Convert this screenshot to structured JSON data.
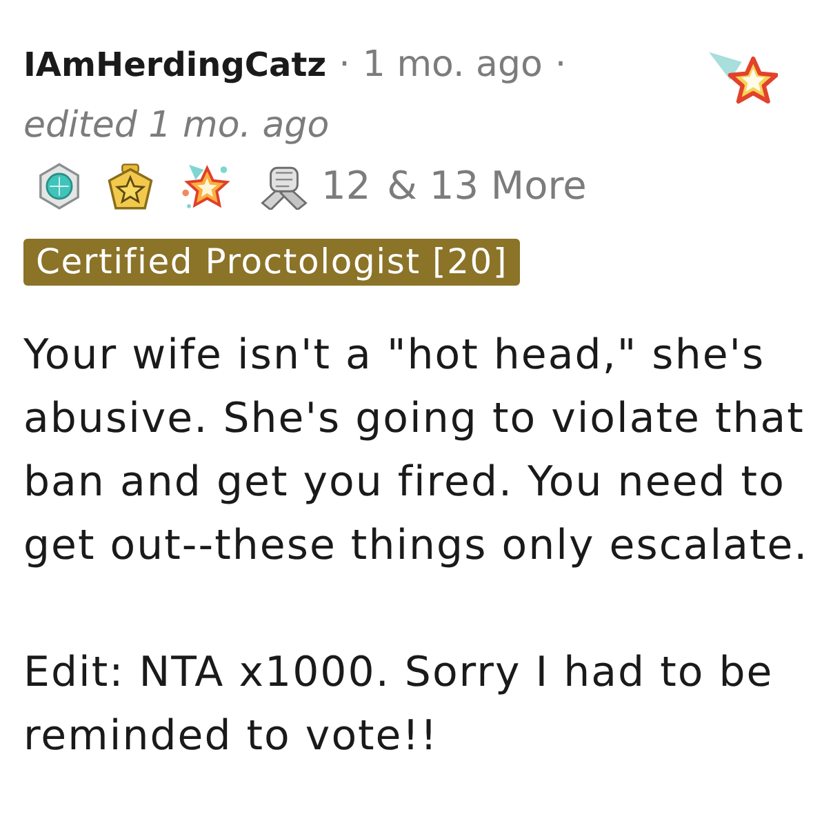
{
  "comment": {
    "author": "IAmHerdingCatz",
    "separator_1": "·",
    "time": "1 mo. ago",
    "separator_2": "·",
    "edited": "edited 1 mo. ago",
    "awards": [
      {
        "kind": "medal"
      },
      {
        "kind": "badge"
      },
      {
        "kind": "starburst"
      },
      {
        "kind": "handshake"
      }
    ],
    "award_count": "12",
    "more_awards": "& 13 More",
    "flair": "Certified Proctologist [20]",
    "body": [
      "Your wife isn't a \"hot head,\" she's abusive. She's going to violate that ban and get you fired. You need to get out--these things only escalate.",
      "Edit: NTA x1000. Sorry I had to be reminded to vote!!"
    ]
  }
}
